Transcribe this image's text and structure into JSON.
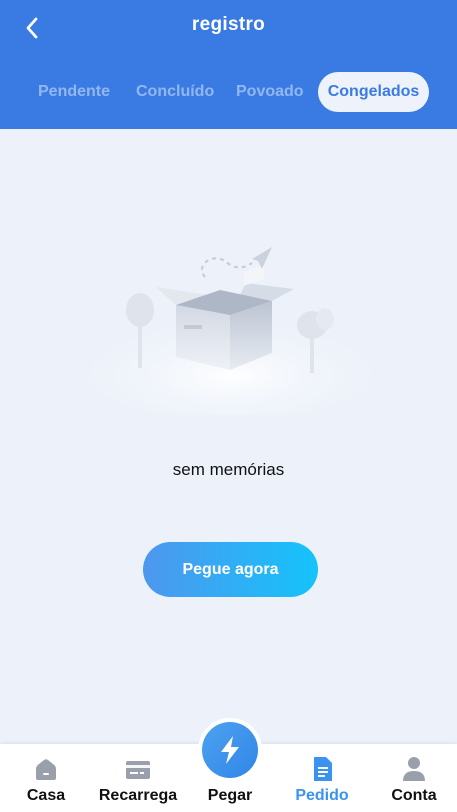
{
  "header": {
    "title": "registro",
    "background_color": "#3a7be3"
  },
  "tabs": [
    {
      "label": "Pendente",
      "active": false
    },
    {
      "label": "Concluído",
      "active": false
    },
    {
      "label": "Povoado",
      "active": false
    },
    {
      "label": "Congelados",
      "active": true
    }
  ],
  "empty_state": {
    "illustration": "empty-box-icon",
    "message": "sem memórias",
    "button_label": "Pegue agora"
  },
  "bottom_nav": {
    "items": [
      {
        "label": "Casa",
        "icon": "home-icon",
        "active": false
      },
      {
        "label": "Recarrega",
        "icon": "card-icon",
        "active": false
      },
      {
        "label": "Pegar",
        "icon": "lightning-icon",
        "active": false
      },
      {
        "label": "Pedido",
        "icon": "document-icon",
        "active": true
      },
      {
        "label": "Conta",
        "icon": "user-icon",
        "active": false
      }
    ],
    "active_color": "#3a93ee"
  }
}
